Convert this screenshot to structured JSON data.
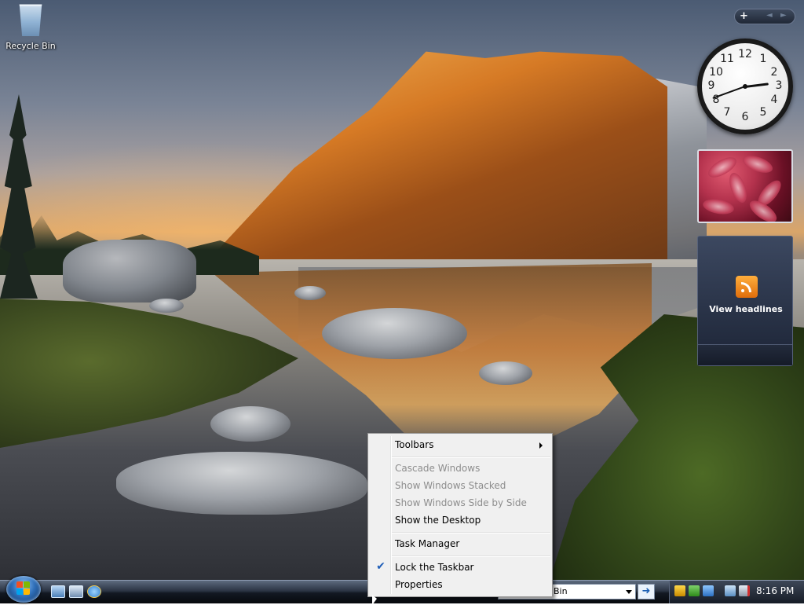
{
  "desktop": {
    "icons": [
      {
        "label": "Recycle Bin"
      }
    ]
  },
  "sidebar": {
    "controls": {
      "add": "+",
      "prev": "◄",
      "next": "►"
    },
    "clock": {
      "numbers": [
        "12",
        "1",
        "2",
        "3",
        "4",
        "5",
        "6",
        "7",
        "8",
        "9",
        "10",
        "11"
      ]
    },
    "feed": {
      "label": "View headlines",
      "icon": "rss-icon"
    }
  },
  "context_menu": {
    "items": [
      {
        "label": "Toolbars",
        "enabled": true,
        "submenu": true
      },
      {
        "label": "Cascade Windows",
        "enabled": false
      },
      {
        "label": "Show Windows Stacked",
        "enabled": false
      },
      {
        "label": "Show Windows Side by Side",
        "enabled": false
      },
      {
        "label": "Show the Desktop",
        "enabled": true
      },
      {
        "label": "Task Manager",
        "enabled": true
      },
      {
        "label": "Lock the Taskbar",
        "enabled": true,
        "checked": true
      },
      {
        "label": "Properties",
        "enabled": true
      }
    ],
    "check_glyph": "✔"
  },
  "taskbar": {
    "address_value": "Bin",
    "go_glyph": "➜",
    "clock": "8:16 PM",
    "quick_launch": [
      "show-desktop-icon",
      "switch-windows-icon",
      "internet-explorer-icon"
    ],
    "tray_icons": [
      "security-shield-icon",
      "network-icon",
      "windows-update-icon",
      "network-connection-icon",
      "volume-muted-icon"
    ]
  }
}
